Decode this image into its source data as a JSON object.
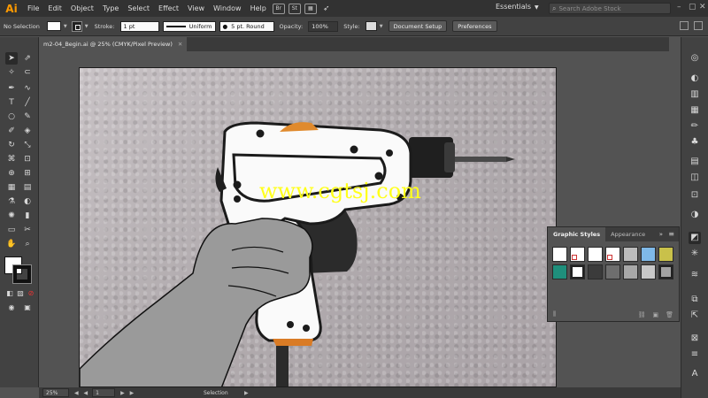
{
  "app": {
    "logo": "Ai",
    "menus": [
      "File",
      "Edit",
      "Object",
      "Type",
      "Select",
      "Effect",
      "View",
      "Window",
      "Help"
    ],
    "menubar_icons": [
      "Br",
      "St"
    ],
    "workspace": "Essentials",
    "stock_search_placeholder": "Search Adobe Stock"
  },
  "control_bar": {
    "selection_label": "No Selection",
    "stroke_label": "Stroke:",
    "stroke_weight": "1 pt",
    "profile": "Uniform",
    "brush": "5 pt. Round",
    "opacity_label": "Opacity:",
    "opacity_value": "100%",
    "style_label": "Style:",
    "document_setup": "Document Setup",
    "preferences": "Preferences"
  },
  "document": {
    "tab_title": "m2-04_Begin.ai @ 25% (CMYK/Pixel Preview)"
  },
  "canvas": {
    "watermark": "www.cgtsj.com"
  },
  "graphic_styles_panel": {
    "tabs": [
      "Graphic Styles",
      "Appearance"
    ],
    "collapse": "»",
    "menu": "≡",
    "swatch_colors": [
      "#ffffff",
      "#ffffff",
      "#ffffff",
      "#ffffff",
      "#bcbcbc",
      "#7fb9e8",
      "#c9c14a",
      "#1f8f7c",
      "#ffffff",
      "#3b3b3b",
      "#6e6e6e",
      "#a8a8a8",
      "#c8c8c8",
      "#a3a3a3"
    ]
  },
  "status_bar": {
    "zoom": "25%",
    "page": "1",
    "nav_prev": "◀ ◀",
    "nav_next": "▶ ▶",
    "tool_name": "Selection"
  },
  "colors": {
    "accent": "#ff9a00",
    "watermark": "#ffff1a",
    "ui_dark": "#323232",
    "ui_mid": "#424242",
    "pasteboard": "#535353"
  }
}
